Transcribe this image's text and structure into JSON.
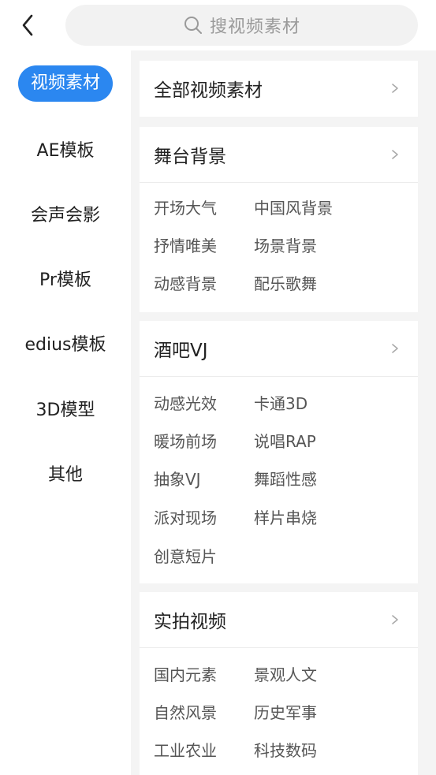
{
  "header": {
    "back_icon": "chevron-left-icon",
    "search_icon": "search-icon",
    "search_placeholder": "搜视频素材"
  },
  "sidebar": {
    "items": [
      {
        "label": "视频素材",
        "active": true
      },
      {
        "label": "AE模板"
      },
      {
        "label": "会声会影"
      },
      {
        "label": "Pr模板"
      },
      {
        "label": "edius模板"
      },
      {
        "label": "3D模型"
      },
      {
        "label": "其他"
      }
    ]
  },
  "colors": {
    "accent": "#2b87f0",
    "content_bg": "#f4f4f4",
    "card_bg": "#ffffff"
  },
  "sections": [
    {
      "title": "全部视频素材",
      "tags": []
    },
    {
      "title": "舞台背景",
      "tags": [
        "开场大气",
        "中国风背景",
        "抒情唯美",
        "场景背景",
        "动感背景",
        "配乐歌舞"
      ]
    },
    {
      "title": "酒吧VJ",
      "tags": [
        "动感光效",
        "卡通3D",
        "暖场前场",
        "说唱RAP",
        "抽象VJ",
        "舞蹈性感",
        "派对现场",
        "样片串烧",
        "创意短片"
      ]
    },
    {
      "title": "实拍视频",
      "tags": [
        "国内元素",
        "景观人文",
        "自然风景",
        "历史军事",
        "工业农业",
        "科技数码"
      ]
    }
  ]
}
